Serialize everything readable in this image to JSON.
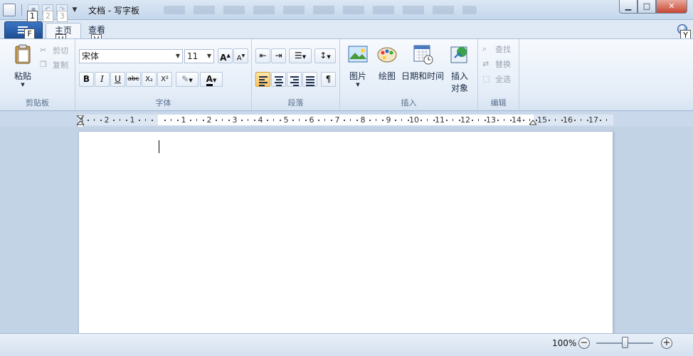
{
  "window": {
    "title": "文档 - 写字板"
  },
  "qat_keytips": [
    "1",
    "2",
    "3"
  ],
  "tabs": [
    {
      "label": "主页",
      "keytip": "H"
    },
    {
      "label": "查看",
      "keytip": "V"
    }
  ],
  "app_menu_keytip": "F",
  "help_keytip": "Y",
  "ribbon": {
    "clipboard": {
      "label": "剪贴板",
      "paste": "粘贴",
      "cut": "剪切",
      "copy": "复制"
    },
    "font": {
      "label": "字体",
      "family": "宋体",
      "size": "11",
      "bold": "B",
      "italic": "I",
      "underline": "U",
      "strike": "abc",
      "sub": "X₂",
      "sup": "X²",
      "grow": "A",
      "shrink": "A"
    },
    "paragraph": {
      "label": "段落"
    },
    "insert": {
      "label": "插入",
      "picture": "图片",
      "paint": "绘图",
      "datetime": "日期和时间",
      "object_line1": "插入",
      "object_line2": "对象"
    },
    "editing": {
      "label": "编辑",
      "find": "查找",
      "replace": "替换",
      "select_all": "全选"
    }
  },
  "ruler": {
    "left_numbers": [
      "3",
      "2",
      "1"
    ],
    "right_numbers": [
      "1",
      "2",
      "3",
      "4",
      "5",
      "6",
      "7",
      "8",
      "9",
      "10",
      "11",
      "12",
      "13",
      "14",
      "15",
      "16",
      "17"
    ]
  },
  "status": {
    "zoom": "100%",
    "zoom_out": "−",
    "zoom_in": "+"
  },
  "colors": {
    "accent": "#1f4f96",
    "ribbon_bg": "#e3ecf7",
    "highlight_active": "#ffc560"
  }
}
